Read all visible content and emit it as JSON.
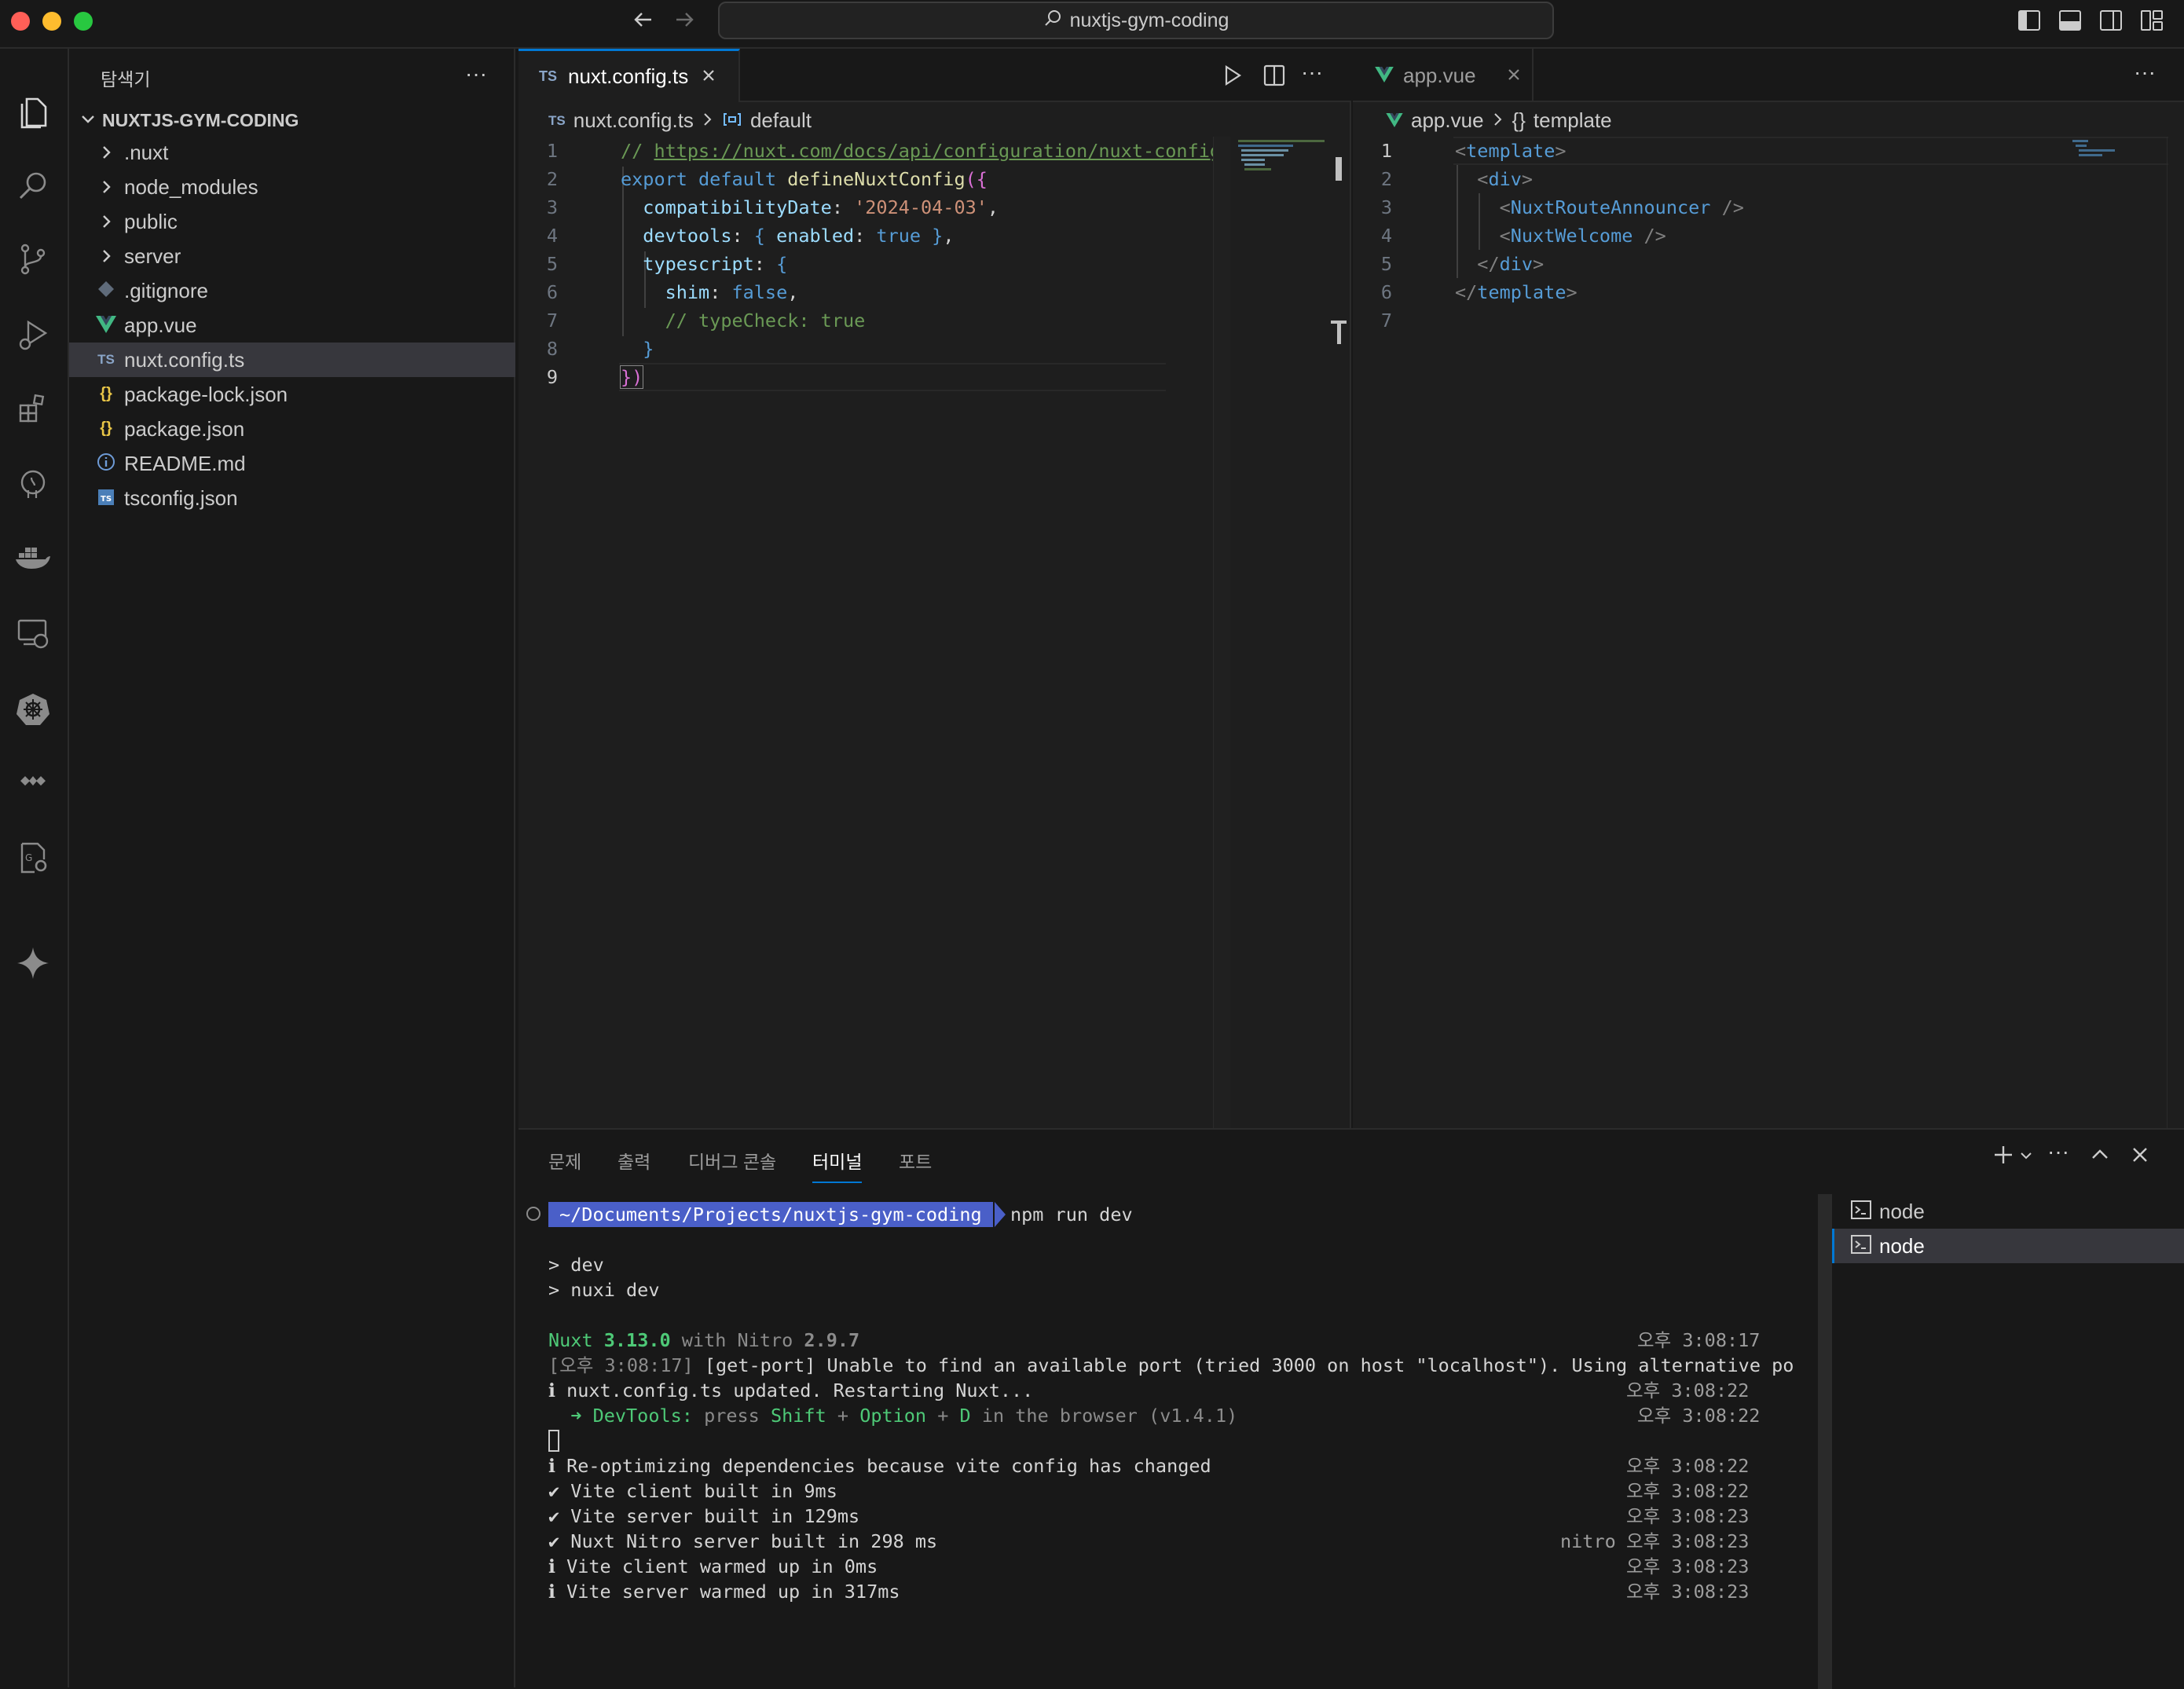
{
  "titlebar": {
    "search_text": "nuxtjs-gym-coding"
  },
  "explorer": {
    "header": "탐색기",
    "root": "NUXTJS-GYM-CODING",
    "items": [
      {
        "label": ".nuxt",
        "type": "folder"
      },
      {
        "label": "node_modules",
        "type": "folder"
      },
      {
        "label": "public",
        "type": "folder"
      },
      {
        "label": "server",
        "type": "folder"
      },
      {
        "label": ".gitignore",
        "type": "git"
      },
      {
        "label": "app.vue",
        "type": "vue"
      },
      {
        "label": "nuxt.config.ts",
        "type": "ts",
        "selected": true
      },
      {
        "label": "package-lock.json",
        "type": "json"
      },
      {
        "label": "package.json",
        "type": "json"
      },
      {
        "label": "README.md",
        "type": "info"
      },
      {
        "label": "tsconfig.json",
        "type": "tsjson"
      }
    ]
  },
  "editor_left": {
    "tab_icon": "TS",
    "tab_label": "nuxt.config.ts",
    "breadcrumb_file": "nuxt.config.ts",
    "breadcrumb_symbol": "default",
    "line_numbers": [
      "1",
      "2",
      "3",
      "4",
      "5",
      "6",
      "7",
      "8",
      "9"
    ],
    "lines": {
      "l1_comment": "// ",
      "l1_url": "https://nuxt.com/docs/api/configuration/nuxt-config",
      "l2_kw": "export default ",
      "l2_fn": "defineNuxtConfig",
      "l2_open": "({",
      "l3_prop": "compatibilityDate",
      "l3_val": "'2024-04-03'",
      "l4_prop": "devtools",
      "l4_inner": "enabled",
      "l4_val": "true",
      "l5_prop": "typescript",
      "l6_prop": "shim",
      "l6_val": "false",
      "l7_comment": "// typeCheck: true",
      "l8": "}",
      "l9": "})"
    }
  },
  "editor_right": {
    "tab_label": "app.vue",
    "breadcrumb_file": "app.vue",
    "breadcrumb_symbol": "template",
    "line_numbers": [
      "1",
      "2",
      "3",
      "4",
      "5",
      "6",
      "7"
    ],
    "lines": {
      "l1_tag": "template",
      "l2_tag": "div",
      "l3_comp": "NuxtRouteAnnouncer",
      "l4_comp": "NuxtWelcome",
      "l5_tag": "div",
      "l6_tag": "template"
    }
  },
  "panel": {
    "tabs": [
      "문제",
      "출력",
      "디버그 콘솔",
      "터미널",
      "포트"
    ],
    "active_tab": "터미널",
    "terminals": [
      "node",
      "node"
    ],
    "prompt_path": "~/Documents/Projects/nuxtjs-gym-coding",
    "command": "npm run dev",
    "output": {
      "dev1": "> dev",
      "dev2": "> nuxi dev",
      "nuxt_label": "Nuxt ",
      "nuxt_version": "3.13.0",
      "with_nitro": " with Nitro ",
      "nitro_version": "2.9.7",
      "ts1": "오후 3:08:17",
      "port_prefix": "[오후 3:08:17]",
      "port_msg": " [get-port] Unable to find an available port (tried 3000 on host \"localhost\"). Using alternative po",
      "restart": "ℹ nuxt.config.ts updated. Restarting Nuxt...",
      "ts2": "오후 3:08:22",
      "devtools_arrow": "  ➜ ",
      "devtools_label": "DevTools:",
      "devtools_press": " press ",
      "devtools_shift": "Shift",
      "devtools_plus1": " + ",
      "devtools_option": "Option",
      "devtools_plus2": " + ",
      "devtools_d": "D",
      "devtools_rest": " in the browser (v1.4.1)",
      "ts3": "오후 3:08:22",
      "reopt": "ℹ Re-optimizing dependencies because vite config has changed",
      "ts4": "오후 3:08:22",
      "vite_client": "✔ Vite client built in 9ms",
      "ts5": "오후 3:08:22",
      "vite_server": "✔ Vite server built in 129ms",
      "ts6": "오후 3:08:23",
      "nitro_built": "✔ Nuxt Nitro server built in 298 ms",
      "nitro_tag": "nitro",
      "ts7": "오후 3:08:23",
      "warm_client": "ℹ Vite client warmed up in 0ms",
      "ts8": "오후 3:08:23",
      "warm_server": "ℹ Vite server warmed up in 317ms",
      "ts9": "오후 3:08:23"
    }
  },
  "colors": {
    "accent": "#0078d4",
    "prompt_bg": "#4a5fc8",
    "vue_green": "#41b883",
    "ts_blue": "#4b7fb8"
  }
}
